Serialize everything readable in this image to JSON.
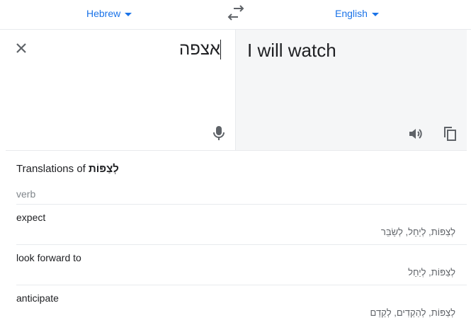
{
  "lang_bar": {
    "source_language": "Hebrew",
    "target_language": "English"
  },
  "source": {
    "text": "אצפה"
  },
  "target": {
    "text": "I will watch"
  },
  "dictionary": {
    "title_prefix": "Translations of",
    "title_word": "לְצַפּוֹת",
    "part_of_speech": "verb",
    "entries": [
      {
        "word": "expect",
        "reverse": "לְצַפּוֹת, לְיַחֵל, לְשַׂבֵּר"
      },
      {
        "word": "look forward to",
        "reverse": "לְצַפּוֹת, לְיַחֵל"
      },
      {
        "word": "anticipate",
        "reverse": "לְצַפּוֹת, לְהַקְדִים, לְקַדֵם"
      }
    ]
  },
  "colors": {
    "accent": "#1a73e8",
    "icon_gray": "#5f6368",
    "target_bg": "#f5f6f7"
  },
  "icons": [
    "chevron-down-icon",
    "swap-icon",
    "close-icon",
    "microphone-icon",
    "speaker-icon",
    "copy-icon"
  ]
}
